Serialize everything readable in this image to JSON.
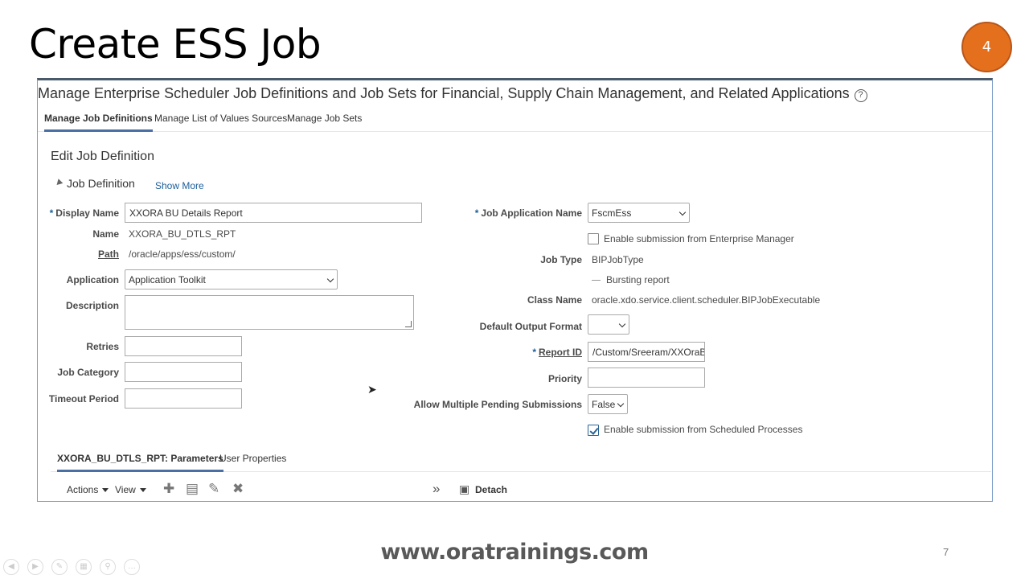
{
  "slide": {
    "title": "Create ESS Job",
    "badge": "4",
    "footer_url": "www.oratrainings.com",
    "page_number": "7"
  },
  "page": {
    "header": "Manage Enterprise Scheduler Job Definitions and Job Sets for Financial, Supply Chain Management, and Related Applications",
    "help_icon": "?",
    "tabs": [
      {
        "label": "Manage Job Definitions"
      },
      {
        "label": "Manage List of Values Sources"
      },
      {
        "label": "Manage Job Sets"
      }
    ],
    "section_title": "Edit Job Definition",
    "job_definition": {
      "heading": "Job Definition",
      "show_more": "Show More",
      "display_name": {
        "label": "Display Name",
        "value": "XXORA BU Details Report"
      },
      "name": {
        "label": "Name",
        "value": "XXORA_BU_DTLS_RPT"
      },
      "path": {
        "label": "Path",
        "value": "/oracle/apps/ess/custom/"
      },
      "application": {
        "label": "Application",
        "value": "Application Toolkit"
      },
      "description": {
        "label": "Description",
        "value": ""
      },
      "retries": {
        "label": "Retries",
        "value": ""
      },
      "job_category": {
        "label": "Job Category",
        "value": ""
      },
      "timeout_period": {
        "label": "Timeout Period",
        "value": ""
      },
      "job_application_name": {
        "label": "Job Application Name",
        "value": "FscmEss"
      },
      "enable_em": {
        "label": "Enable submission from Enterprise Manager",
        "checked": false
      },
      "job_type": {
        "label": "Job Type",
        "value": "BIPJobType"
      },
      "bursting": {
        "label": "Bursting report"
      },
      "class_name": {
        "label": "Class Name",
        "value": "oracle.xdo.service.client.scheduler.BIPJobExecutable"
      },
      "default_output_format": {
        "label": "Default Output Format",
        "value": ""
      },
      "report_id": {
        "label": "Report ID",
        "value": "/Custom/Sreeram/XXOraBU"
      },
      "priority": {
        "label": "Priority",
        "value": ""
      },
      "allow_multiple": {
        "label": "Allow Multiple Pending Submissions",
        "value": "False"
      },
      "enable_scheduled": {
        "label": "Enable submission from Scheduled Processes",
        "checked": true
      }
    },
    "subtabs": [
      {
        "label": "XXORA_BU_DTLS_RPT: Parameters"
      },
      {
        "label": "User Properties"
      }
    ],
    "toolbar": {
      "actions": "Actions",
      "view": "View",
      "detach": "Detach",
      "icons": [
        "plus-icon",
        "clipboard-icon",
        "pencil-icon",
        "close-icon",
        "double-chevron-icon",
        "detach-icon"
      ]
    }
  }
}
